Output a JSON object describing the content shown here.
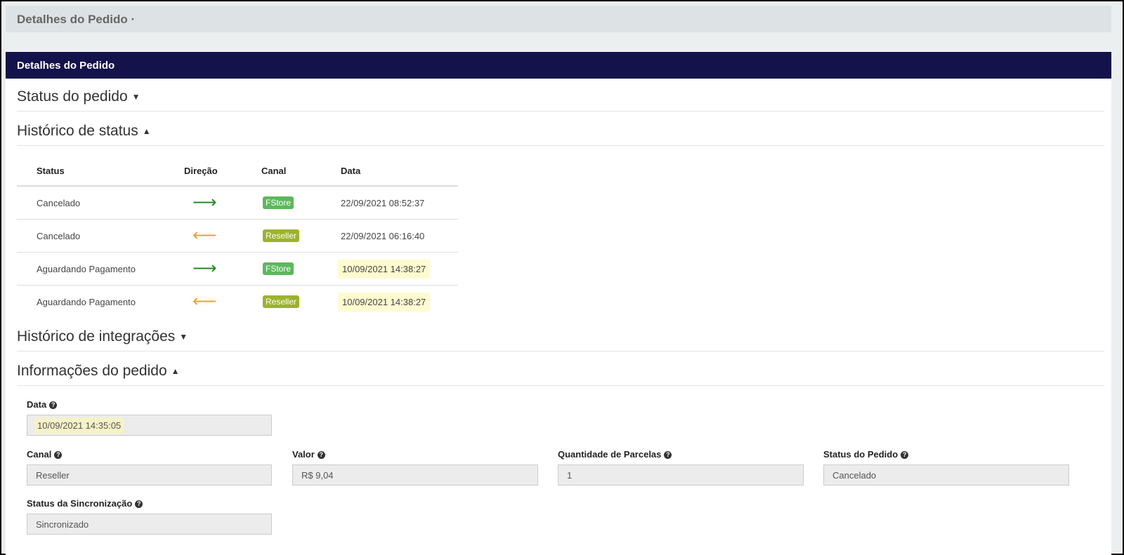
{
  "top_bar": {
    "title": "Detalhes do Pedido ·"
  },
  "panel": {
    "header": "Detalhes do Pedido"
  },
  "sections": {
    "status_pedido": "Status do pedido",
    "historico_status": "Histórico de status",
    "historico_integracoes": "Histórico de integrações",
    "informacoes_pedido": "Informações do pedido"
  },
  "status_table": {
    "headers": [
      "Status",
      "Direção",
      "Canal",
      "Data"
    ],
    "rows": [
      {
        "status": "Cancelado",
        "direction": "right",
        "canal": "FStore",
        "data": "22/09/2021 08:52:37"
      },
      {
        "status": "Cancelado",
        "direction": "left",
        "canal": "Reseller",
        "data": "22/09/2021 06:16:40"
      },
      {
        "status": "Aguardando Pagamento",
        "direction": "right",
        "canal": "FStore",
        "data": "10/09/2021 14:38:27"
      },
      {
        "status": "Aguardando Pagamento",
        "direction": "left",
        "canal": "Reseller",
        "data": "10/09/2021 14:38:27"
      }
    ],
    "arrow_glyphs": {
      "right": "⟶",
      "left": "⟵"
    },
    "colors": {
      "right": "#1f8a1f",
      "left": "#f5a023",
      "fstore": "#5cb85c",
      "reseller": "#9bb32c"
    }
  },
  "info": {
    "data_label": "Data",
    "data_value": "10/09/2021 14:35:05",
    "canal_label": "Canal",
    "canal_value": "Reseller",
    "valor_label": "Valor",
    "valor_value": "R$ 9,04",
    "parcelas_label": "Quantidade de Parcelas",
    "parcelas_value": "1",
    "status_pedido_label": "Status do Pedido",
    "status_pedido_value": "Cancelado",
    "sync_label": "Status da Sincronização",
    "sync_value": "Sincronizado",
    "help_icon": "?"
  },
  "colors": {
    "header_bg": "#14124a"
  }
}
